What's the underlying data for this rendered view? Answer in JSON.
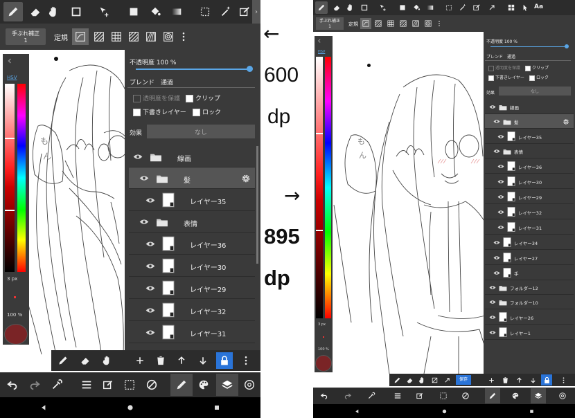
{
  "annotations": {
    "arrow_left": "←",
    "width_value": "600",
    "width_unit": "dp",
    "arrow_right": "→",
    "height_value": "895",
    "height_unit": "dp"
  },
  "colors": {
    "accent": "#5aa6e6",
    "panel": "#3a3a3a",
    "toolbar": "#2c2c2c",
    "lock_blue": "#2a74d8",
    "save_blue": "#2a74d8"
  },
  "left": {
    "tool_subbar": {
      "stabilizer_label": "手ぶれ補正",
      "stabilizer_value": "1",
      "ruler_label": "定規"
    },
    "color": {
      "mode": "HSV",
      "brush_size": "3 px",
      "opacity": "100 %"
    },
    "props": {
      "opacity_label": "不透明度 100 %",
      "blend_label": "ブレンド",
      "blend_value": "通過",
      "protect_alpha": "透明度を保護",
      "clipping": "クリップ",
      "draft_layer": "下書きレイヤー",
      "lock": "ロック",
      "effect_label": "効果",
      "effect_value": "なし"
    },
    "layers": [
      {
        "name": "線画",
        "kind": "folder",
        "indent": 0
      },
      {
        "name": "髪",
        "kind": "folder",
        "indent": 1
      },
      {
        "name": "レイヤー35",
        "kind": "layer",
        "indent": 2
      },
      {
        "name": "表情",
        "kind": "folder",
        "indent": 1
      },
      {
        "name": "レイヤー36",
        "kind": "layer",
        "indent": 2
      },
      {
        "name": "レイヤー30",
        "kind": "layer",
        "indent": 2
      },
      {
        "name": "レイヤー29",
        "kind": "layer",
        "indent": 2
      },
      {
        "name": "レイヤー32",
        "kind": "layer",
        "indent": 2
      },
      {
        "name": "レイヤー31",
        "kind": "layer",
        "indent": 2
      }
    ]
  },
  "right": {
    "tool_subbar": {
      "stabilizer_label": "手ぶれ補正",
      "stabilizer_value": "1",
      "ruler_label": "定規",
      "text_tool": "Aa"
    },
    "color": {
      "mode": "HSV",
      "brush_size": "3 px",
      "opacity": "100 %"
    },
    "props": {
      "opacity_label": "不透明度 100 %",
      "blend_label": "ブレンド",
      "blend_value": "通過",
      "protect_alpha": "透明度を保護",
      "clipping": "クリップ",
      "draft_layer": "下書きレイヤー",
      "lock": "ロック",
      "effect_label": "効果",
      "effect_value": "なし"
    },
    "save_label": "保存",
    "layers": [
      {
        "name": "線画",
        "kind": "folder",
        "indent": 0
      },
      {
        "name": "髪",
        "kind": "folder",
        "indent": 1
      },
      {
        "name": "レイヤー35",
        "kind": "layer",
        "indent": 2
      },
      {
        "name": "表情",
        "kind": "folder",
        "indent": 1
      },
      {
        "name": "レイヤー36",
        "kind": "layer",
        "indent": 2
      },
      {
        "name": "レイヤー30",
        "kind": "layer",
        "indent": 2
      },
      {
        "name": "レイヤー29",
        "kind": "layer",
        "indent": 2
      },
      {
        "name": "レイヤー32",
        "kind": "layer",
        "indent": 2
      },
      {
        "name": "レイヤー31",
        "kind": "layer",
        "indent": 2
      },
      {
        "name": "レイヤー34",
        "kind": "layer",
        "indent": 1
      },
      {
        "name": "レイヤー27",
        "kind": "layer",
        "indent": 1
      },
      {
        "name": "手",
        "kind": "layer",
        "indent": 1
      },
      {
        "name": "フォルダー12",
        "kind": "folder",
        "indent": 0
      },
      {
        "name": "フォルダー10",
        "kind": "folder",
        "indent": 0
      },
      {
        "name": "レイヤー26",
        "kind": "layer",
        "indent": 0
      },
      {
        "name": "レイヤー1",
        "kind": "layer",
        "indent": 0
      }
    ]
  }
}
